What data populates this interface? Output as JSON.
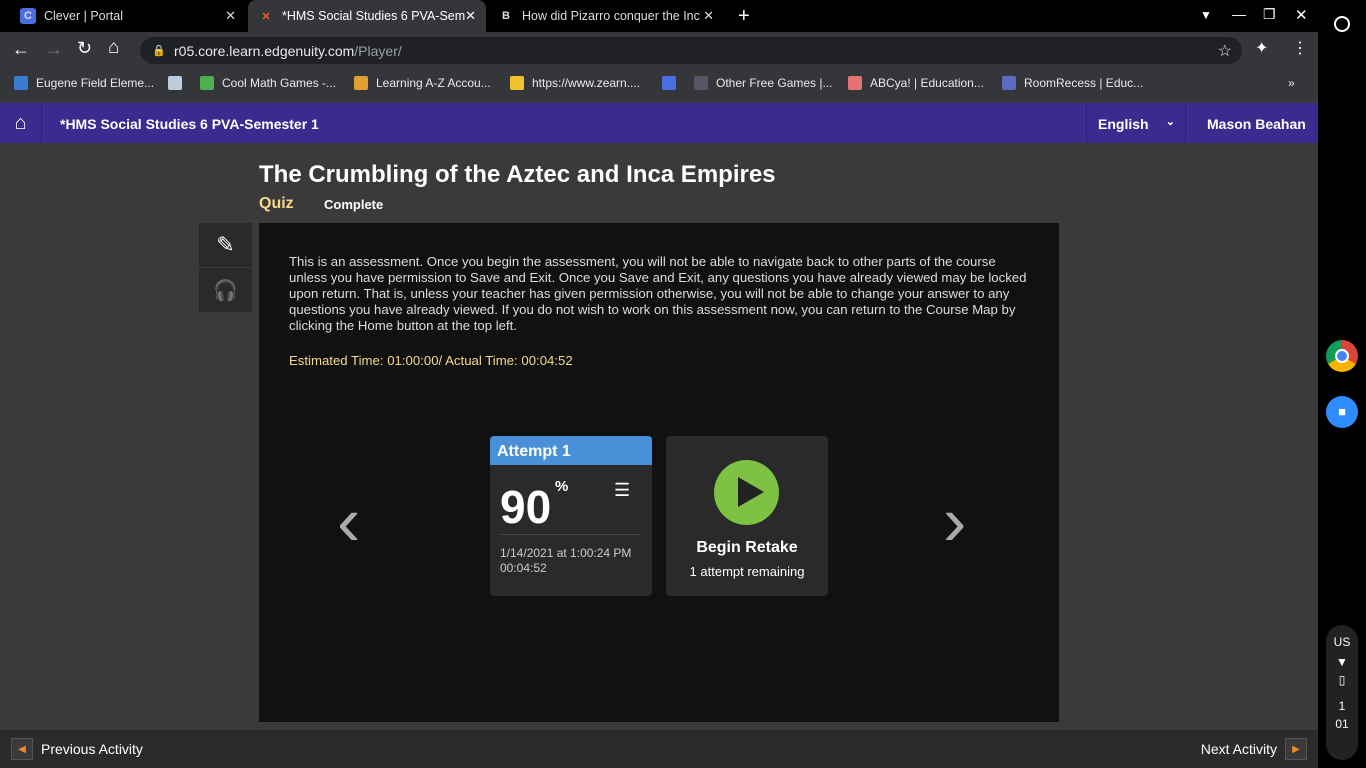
{
  "browser": {
    "tabs": [
      {
        "title": "Clever | Portal"
      },
      {
        "title": "*HMS Social Studies 6 PVA-Sem"
      },
      {
        "title": "How did Pizarro conquer the Inc"
      }
    ],
    "url_host": "r05.core.learn.edgenuity.com",
    "url_path": "/Player/",
    "bookmarks": [
      "Eugene Field Eleme...",
      "Cool Math Games -...",
      "Learning A-Z Accou...",
      "https://www.zearn....",
      "Other Free Games |...",
      "ABCya! | Education...",
      "RoomRecess | Educ..."
    ]
  },
  "app": {
    "course": "*HMS Social Studies 6 PVA-Semester 1",
    "language": "English",
    "user": "Mason Beahan"
  },
  "lesson": {
    "title": "The Crumbling of the Aztec and Inca Empires",
    "type": "Quiz",
    "status": "Complete",
    "instructions": "This is an assessment. Once you begin the assessment, you will not be able to navigate back to other parts of the course unless you have permission to Save and Exit. Once you Save and Exit, any questions you have already viewed may be locked upon return. That is, unless your teacher has given permission otherwise, you will not be able to change your answer to any questions you have already viewed. If you do not wish to work on this assessment now, you can return to the Course Map by clicking the Home button at the top left.",
    "time": "Estimated Time: 01:00:00/ Actual Time: 00:04:52"
  },
  "attempt": {
    "label": "Attempt 1",
    "score": "90",
    "unit": "%",
    "date": "1/14/2021 at 1:00:24 PM",
    "duration": "00:04:52"
  },
  "retake": {
    "label": "Begin Retake",
    "remaining": "1 attempt remaining"
  },
  "footer": {
    "prev": "Previous Activity",
    "next": "Next Activity"
  },
  "shelf": {
    "locale": "US",
    "time_h": "1",
    "time_m": "01"
  },
  "colors": {
    "header": "#3d2a8f",
    "attempt": "#4a90d9",
    "play": "#7dc242",
    "quiz": "#f5d98b"
  }
}
